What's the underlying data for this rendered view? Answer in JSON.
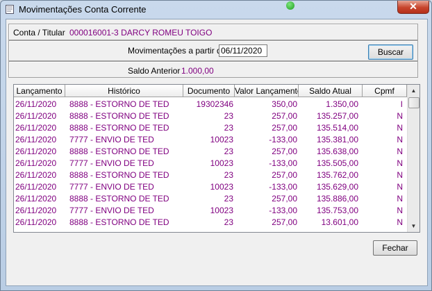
{
  "window": {
    "title": "Movimentações Conta Corrente",
    "close_glyph": "✕"
  },
  "account": {
    "label": "Conta / Titular",
    "value": "000016001-3  DARCY ROMEU TOIGO"
  },
  "filter": {
    "label": "Movimentações a partir de",
    "date": "06/11/2020",
    "search_label": "Buscar"
  },
  "balance": {
    "label": "Saldo Anterior",
    "value": "1.000,00"
  },
  "table": {
    "columns": [
      "Lançamento",
      "Histórico",
      "Documento",
      "Valor Lançamento",
      "Saldo Atual",
      "Cpmf"
    ],
    "rows": [
      [
        "26/11/2020",
        "8888 - ESTORNO DE TED",
        "19302346",
        "350,00",
        "1.350,00",
        "I"
      ],
      [
        "26/11/2020",
        "8888 - ESTORNO DE TED",
        "23",
        "257,00",
        "135.257,00",
        "N"
      ],
      [
        "26/11/2020",
        "8888 - ESTORNO DE TED",
        "23",
        "257,00",
        "135.514,00",
        "N"
      ],
      [
        "26/11/2020",
        "7777 - ENVIO DE TED",
        "10023",
        "-133,00",
        "135.381,00",
        "N"
      ],
      [
        "26/11/2020",
        "8888 - ESTORNO DE TED",
        "23",
        "257,00",
        "135.638,00",
        "N"
      ],
      [
        "26/11/2020",
        "7777 - ENVIO DE TED",
        "10023",
        "-133,00",
        "135.505,00",
        "N"
      ],
      [
        "26/11/2020",
        "8888 - ESTORNO DE TED",
        "23",
        "257,00",
        "135.762,00",
        "N"
      ],
      [
        "26/11/2020",
        "7777 - ENVIO DE TED",
        "10023",
        "-133,00",
        "135.629,00",
        "N"
      ],
      [
        "26/11/2020",
        "8888 - ESTORNO DE TED",
        "23",
        "257,00",
        "135.886,00",
        "N"
      ],
      [
        "26/11/2020",
        "7777 - ENVIO DE TED",
        "10023",
        "-133,00",
        "135.753,00",
        "N"
      ],
      [
        "26/11/2020",
        "8888 - ESTORNO DE TED",
        "23",
        "257,00",
        "13.601,00",
        "N"
      ]
    ]
  },
  "footer": {
    "close_label": "Fechar"
  },
  "colors": {
    "data_text": "#800080",
    "window_frame": "#b9cde4",
    "close_button": "#c7442c"
  }
}
